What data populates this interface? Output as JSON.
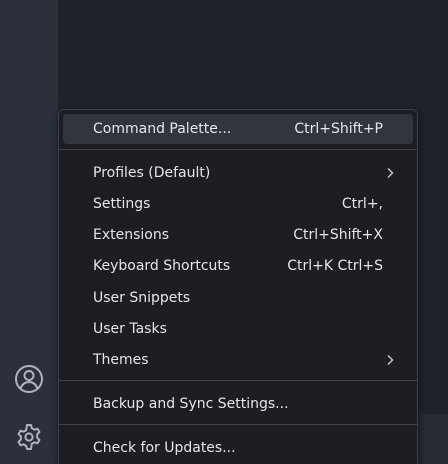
{
  "menu": {
    "items": [
      {
        "label": "Command Palette...",
        "shortcut": "Ctrl+Shift+P"
      },
      {
        "label": "Profiles (Default)",
        "shortcut": ""
      },
      {
        "label": "Settings",
        "shortcut": "Ctrl+,"
      },
      {
        "label": "Extensions",
        "shortcut": "Ctrl+Shift+X"
      },
      {
        "label": "Keyboard Shortcuts",
        "shortcut": "Ctrl+K Ctrl+S"
      },
      {
        "label": "User Snippets",
        "shortcut": ""
      },
      {
        "label": "User Tasks",
        "shortcut": ""
      },
      {
        "label": "Themes",
        "shortcut": ""
      },
      {
        "label": "Backup and Sync Settings...",
        "shortcut": ""
      },
      {
        "label": "Check for Updates...",
        "shortcut": ""
      }
    ],
    "submenu_icon": "chevron-right-icon"
  },
  "activity_bar": {
    "accounts_icon": "account-icon",
    "manage_icon": "gear-icon"
  },
  "colors": {
    "menu_background": "#1c1e24",
    "highlight": "#31353d",
    "activity_bar": "#2b303b",
    "text": "#e4e6ea"
  }
}
